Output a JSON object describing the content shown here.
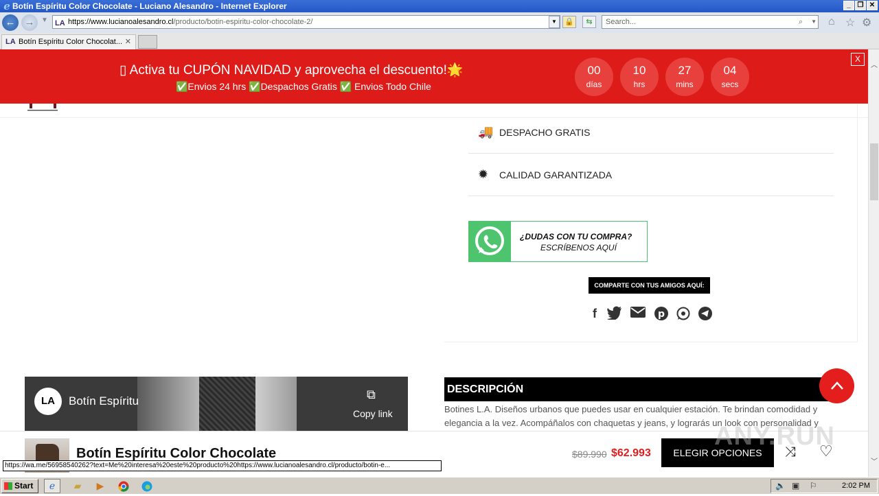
{
  "window": {
    "title": "Botín Espíritu Color Chocolate - Luciano Alesandro - Internet Explorer",
    "url_host": "https://www.lucianoalesandro.cl",
    "url_path": "/producto/botin-espiritu-color-chocolate-2/",
    "search_placeholder": "Search...",
    "tab_label": "Botín Espíritu Color Chocolat...",
    "favicon_text": "LA"
  },
  "banner": {
    "headline": "▯ Activa tu CUPÓN NAVIDAD y aprovecha el descuento!🌟",
    "subline": "✅Envios 24 hrs ✅Despachos Gratis ✅ Envios Todo Chile",
    "countdown": [
      {
        "value": "00",
        "unit": "días"
      },
      {
        "value": "10",
        "unit": "hrs"
      },
      {
        "value": "27",
        "unit": "mins"
      },
      {
        "value": "04",
        "unit": "secs"
      }
    ],
    "close_label": "X"
  },
  "features": [
    {
      "icon": "delivery-truck-icon",
      "label": "DESPACHO GRATIS"
    },
    {
      "icon": "quality-badge-icon",
      "label": "CALIDAD GARANTIZADA"
    }
  ],
  "whatsapp_banner": {
    "line1": "¿DUDAS CON TU COMPRA?",
    "line2": "ESCRÍBENOS AQUÍ"
  },
  "share": {
    "label": "COMPARTE CON TUS AMIGOS AQUÍ:",
    "icons": [
      "facebook-icon",
      "twitter-icon",
      "email-icon",
      "pinterest-icon",
      "whatsapp-icon",
      "telegram-icon"
    ]
  },
  "video": {
    "channel_avatar": "LA",
    "title": "Botín Espíritu",
    "copy_link": "Copy link"
  },
  "description": {
    "heading": "DESCRIPCIÓN",
    "text": "Botines L.A. Diseños urbanos que puedes usar en cualquier estación. Te brindan comodidad y elegancia a la vez. Acompáñalos con chaquetas y jeans, y lograrás un look con personalidad y"
  },
  "sticky_bar": {
    "product_name": "Botín Espíritu Color Chocolate",
    "old_price": "$89.990",
    "new_price": "$62.993",
    "button_label": "ELEGIR OPCIONES"
  },
  "status_url": "https://wa.me/56958540262?text=Me%20interesa%20este%20producto%20https://www.lucianoalesandro.cl/producto/botin-e...",
  "watermark": "ANY.RUN",
  "taskbar": {
    "start_label": "Start",
    "clock": "2:02 PM"
  },
  "colors": {
    "banner_red": "#dd1c1a",
    "price_red": "#e21e1c",
    "whatsapp_green": "#4ec46f"
  }
}
